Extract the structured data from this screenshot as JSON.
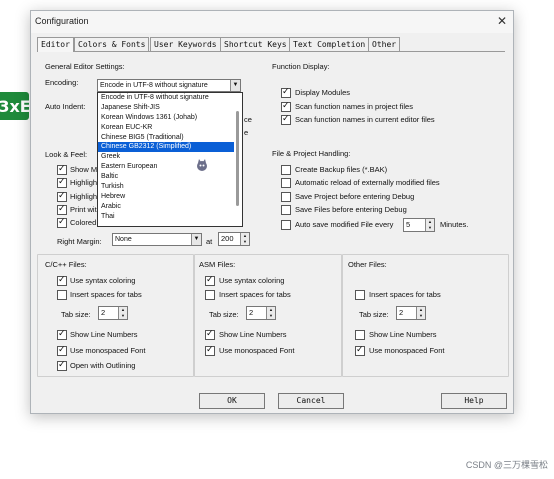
{
  "side_badge": "3xE",
  "dialog": {
    "title": "Configuration",
    "close_glyph": "✕"
  },
  "tabs": [
    "Editor",
    "Colors & Fonts",
    "User Keywords",
    "Shortcut Keys",
    "Text Completion",
    "Other"
  ],
  "general": {
    "header": "General Editor Settings:",
    "encoding_label": "Encoding:",
    "encoding_value": "Encode in UTF-8 without signature",
    "auto_indent_label": "Auto Indent:",
    "hidden_text_1": "ce",
    "hidden_text_2": "e",
    "encoding_options": [
      "Encode in UTF-8 without signature",
      "Japanese Shift-JIS",
      "Korean Windows 1361 (Johab)",
      "Korean EUC-KR",
      "Chinese BIG5 (Traditional)",
      "Chinese GB2312 (Simplified)",
      "Greek",
      "Eastern European",
      "Baltic",
      "Turkish",
      "Hebrew",
      "Arabic",
      "Thai"
    ]
  },
  "look_feel": {
    "header": "Look & Feel:",
    "items": [
      "Show M",
      "Highligh",
      "Highligh",
      "Print wit",
      "Colored"
    ],
    "right_margin_label": "Right Margin:",
    "right_margin_value": "None",
    "at_label": "at",
    "at_value": "200"
  },
  "function_display": {
    "header": "Function Display:",
    "items": [
      {
        "label": "Display Modules",
        "checked": true
      },
      {
        "label": "Scan function names in project files",
        "checked": true
      },
      {
        "label": "Scan function names in current editor files",
        "checked": true
      }
    ]
  },
  "file_project": {
    "header": "File & Project Handling:",
    "items": [
      {
        "label": "Create Backup files (*.BAK)",
        "checked": false
      },
      {
        "label": "Automatic reload of externally modified files",
        "checked": false
      },
      {
        "label": "Save Project before entering Debug",
        "checked": false
      },
      {
        "label": "Save Files before entering Debug",
        "checked": false
      },
      {
        "label": "Auto save modified File every",
        "checked": false
      }
    ],
    "auto_save_value": "5",
    "minutes_label": "Minutes."
  },
  "c_files": {
    "header": "C/C++ Files:",
    "use_syntax": "Use syntax coloring",
    "insert_spaces": "Insert spaces for tabs",
    "tab_size_label": "Tab size:",
    "tab_size_value": "2",
    "show_line_numbers": "Show Line Numbers",
    "monospaced": "Use monospaced Font",
    "open_outlining": "Open with Outlining"
  },
  "asm_files": {
    "header": "ASM Files:",
    "use_syntax": "Use syntax coloring",
    "insert_spaces": "Insert spaces for tabs",
    "tab_size_label": "Tab size:",
    "tab_size_value": "2",
    "show_line_numbers": "Show Line Numbers",
    "monospaced": "Use monospaced Font"
  },
  "other_files": {
    "header": "Other Files:",
    "insert_spaces": "Insert spaces for tabs",
    "tab_size_label": "Tab size:",
    "tab_size_value": "2",
    "show_line_numbers": "Show Line Numbers",
    "monospaced": "Use monospaced Font"
  },
  "buttons": {
    "ok": "OK",
    "cancel": "Cancel",
    "help": "Help"
  },
  "watermark": "CSDN @三万棵雪松"
}
